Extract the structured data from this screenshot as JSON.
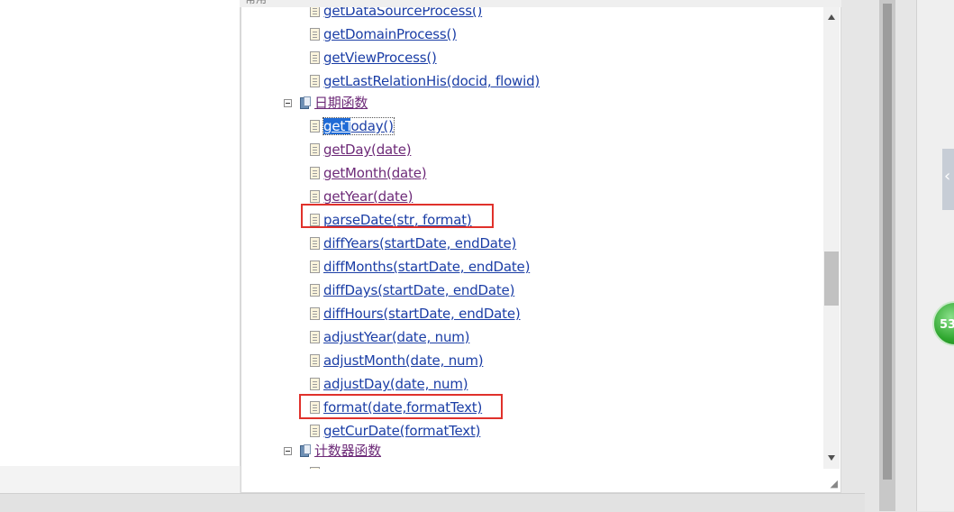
{
  "header_fragment": "常用",
  "tree": {
    "items": [
      {
        "label": "getDataSourceProcess()",
        "visited": false
      },
      {
        "label": "getDomainProcess()",
        "visited": false
      },
      {
        "label": "getViewProcess()",
        "visited": false
      },
      {
        "label": "getLastRelationHis(docid, flowid)",
        "visited": false
      }
    ],
    "date_category": {
      "label": "日期函数",
      "selected": {
        "label_highlight": "getT",
        "label_rest": "oday()"
      },
      "items": [
        {
          "label": "getDay(date)",
          "visited": true
        },
        {
          "label": "getMonth(date)",
          "visited": true
        },
        {
          "label": "getYear(date)",
          "visited": true
        },
        {
          "label": "parseDate(str, format)",
          "visited": false
        },
        {
          "label": "diffYears(startDate, endDate)",
          "visited": false
        },
        {
          "label": "diffMonths(startDate, endDate)",
          "visited": false
        },
        {
          "label": "diffDays(startDate, endDate)",
          "visited": false
        },
        {
          "label": "diffHours(startDate, endDate)",
          "visited": false
        },
        {
          "label": "adjustYear(date, num)",
          "visited": false
        },
        {
          "label": "adjustMonth(date, num)",
          "visited": false
        },
        {
          "label": "adjustDay(date, num)",
          "visited": false
        },
        {
          "label": "format(date,formatText)",
          "visited": false
        },
        {
          "label": "getCurDate(formatText)",
          "visited": false
        }
      ]
    },
    "counter_category": {
      "label": "计数器函数"
    }
  },
  "side_badge": {
    "text": "53"
  },
  "colors": {
    "highlight_box": "#e0312b",
    "link": "#1b3ea6",
    "visited_link": "#6d2a78",
    "selection": "#1f6bd6"
  },
  "icons": [
    "doc-icon",
    "book-icon",
    "collapse-minus-icon",
    "scroll-up-icon",
    "scroll-down-icon",
    "resize-grip-icon",
    "chevron-left-icon"
  ]
}
